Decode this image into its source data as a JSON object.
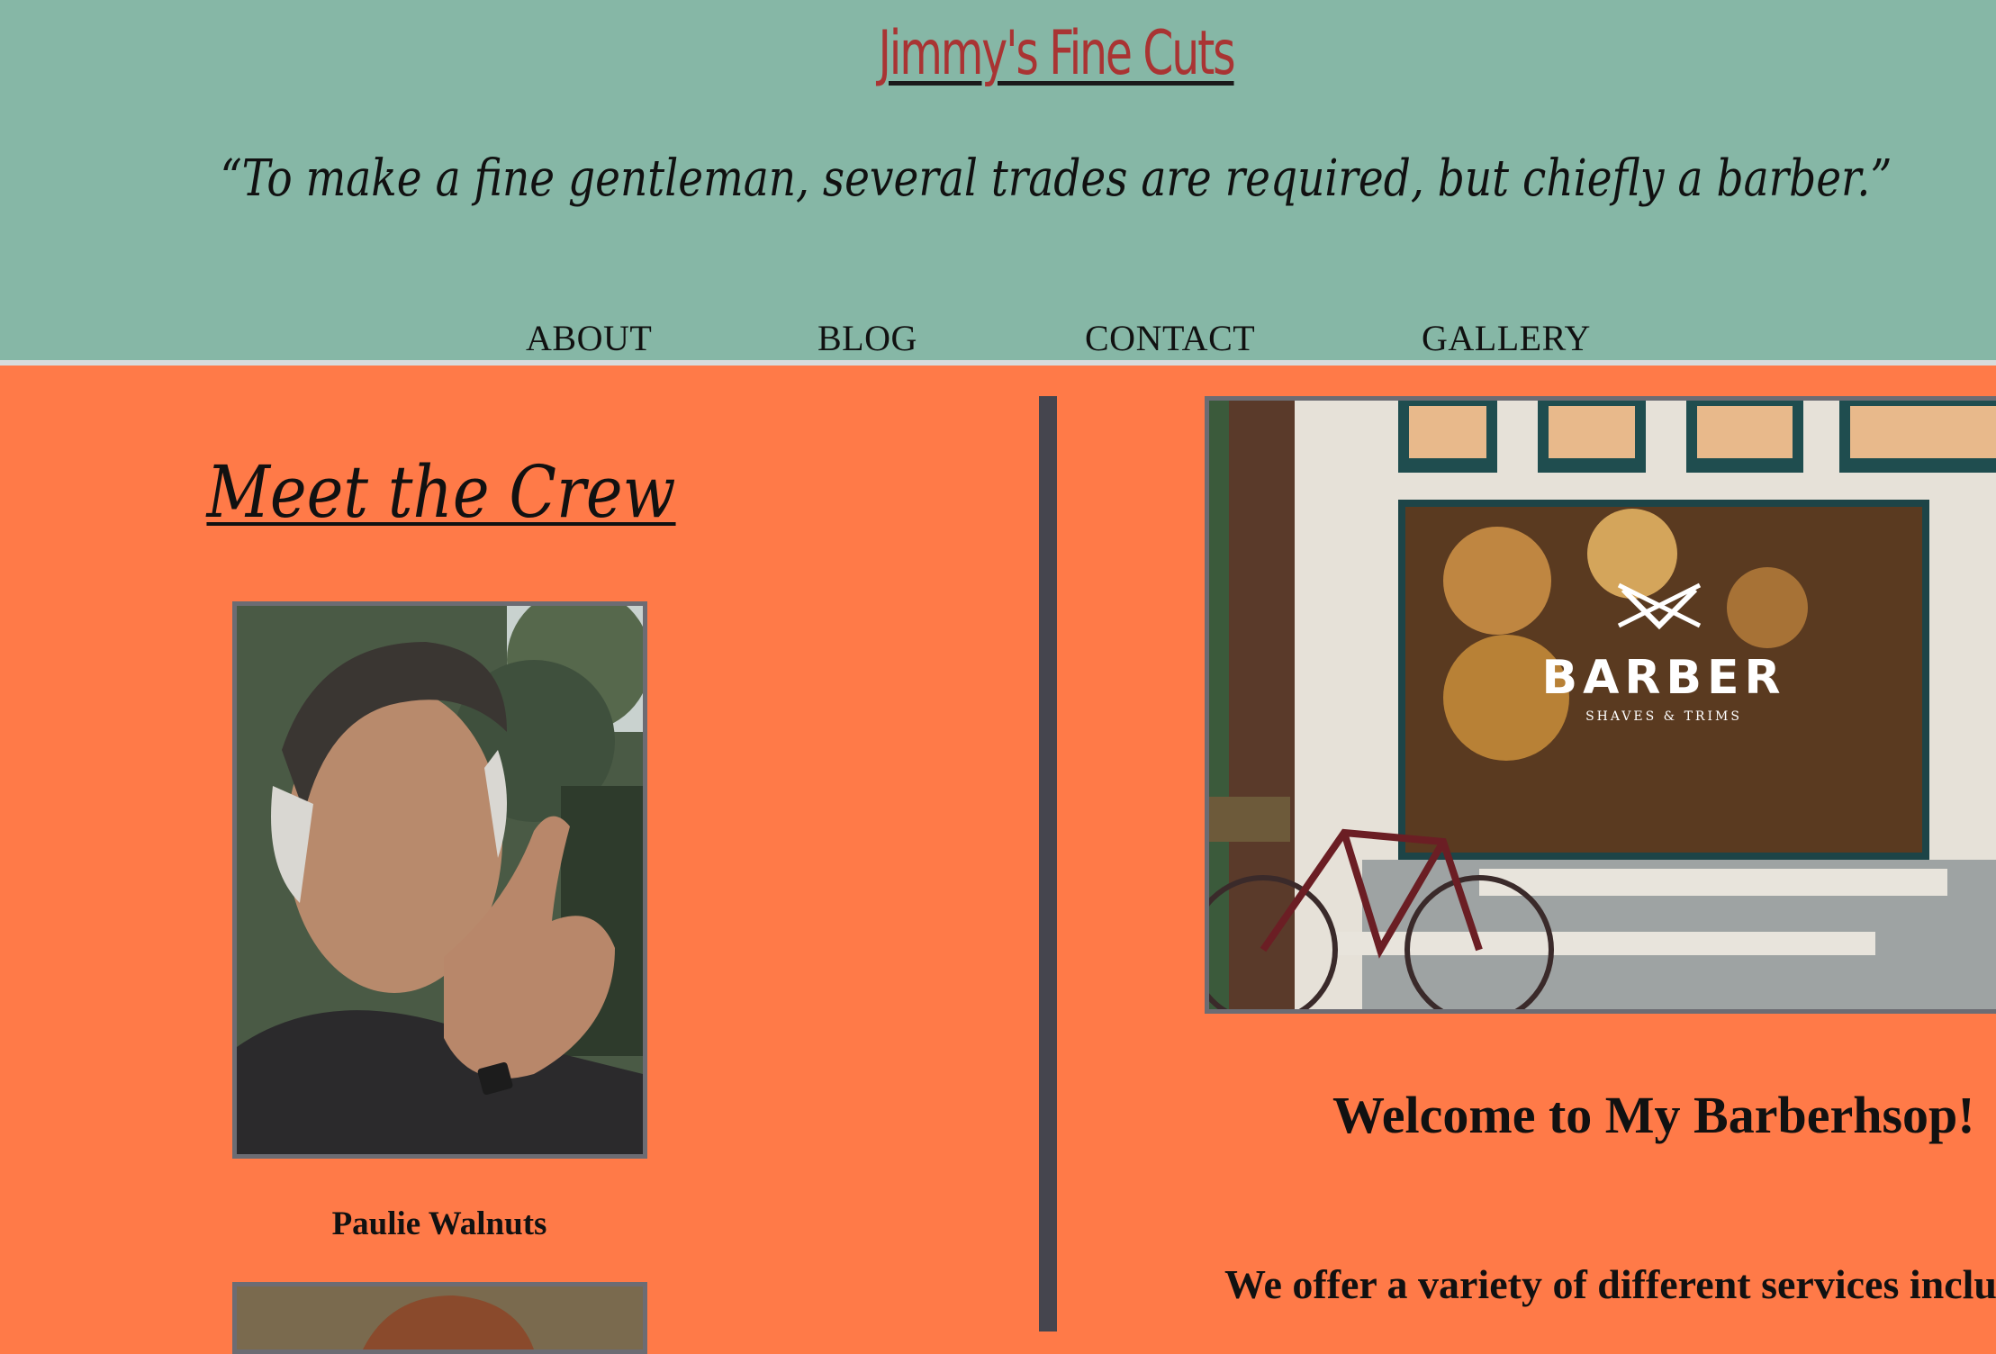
{
  "header": {
    "title": "Jimmy's Fine Cuts",
    "tagline": "“To make a fine gentleman, several trades are required, but chiefly a barber.”",
    "nav": [
      "ABOUT",
      "BLOG",
      "CONTACT",
      "GALLERY"
    ]
  },
  "crew": {
    "heading": "Meet the Crew",
    "members": [
      {
        "name": "Paulie Walnuts"
      }
    ]
  },
  "main": {
    "shop_sign": "BARBER",
    "shop_sign_sub": "SHAVES & TRIMS",
    "welcome": "Welcome to My Barberhsop!",
    "services_intro": "We offer a variety of different services inclu"
  },
  "colors": {
    "header_bg": "#86B7A6",
    "page_bg": "#FF7A48",
    "title": "#A93433",
    "divider": "#45454E"
  }
}
